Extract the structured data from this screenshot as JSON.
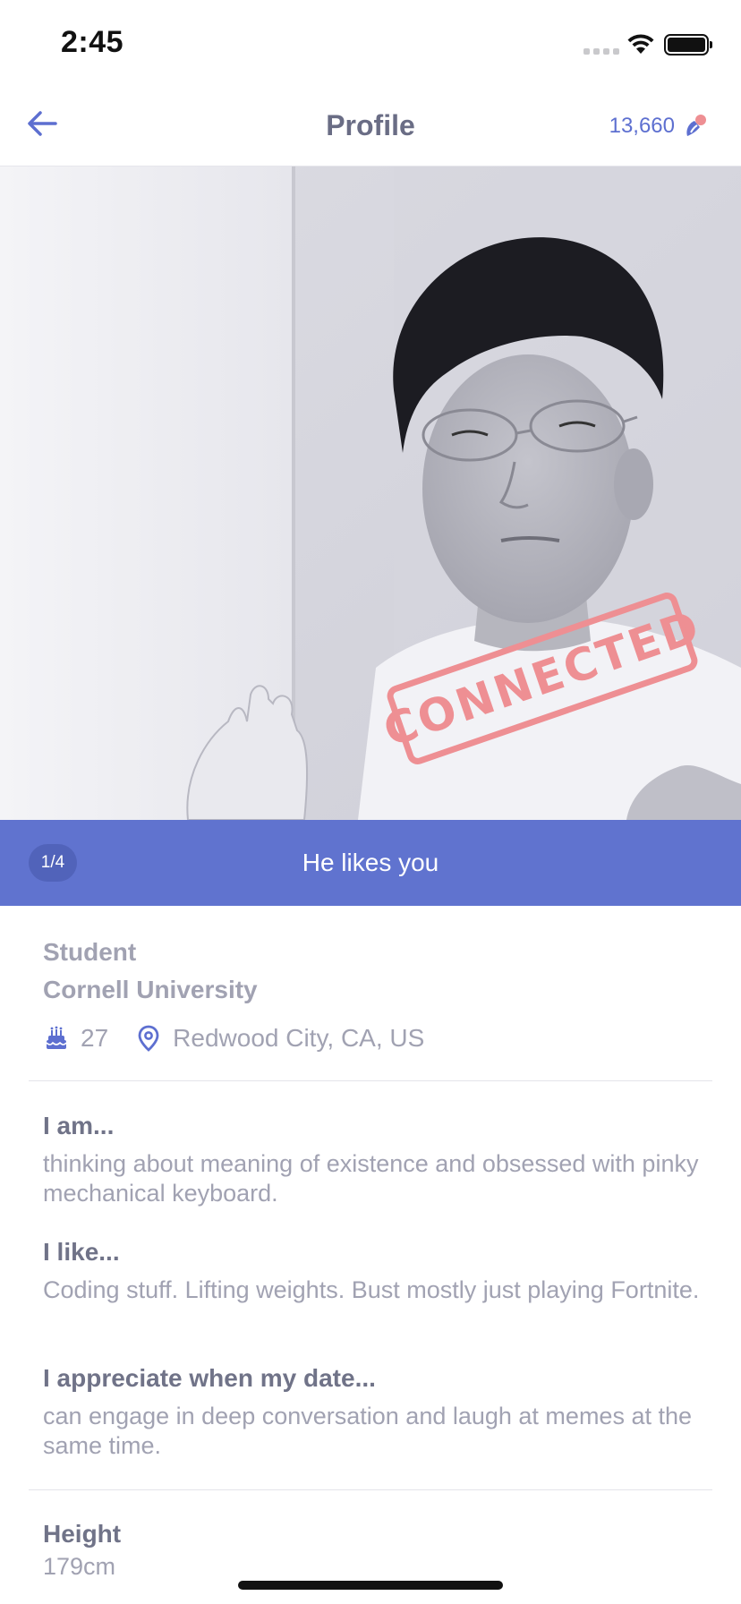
{
  "status_bar": {
    "time": "2:45"
  },
  "nav": {
    "title": "Profile",
    "credits": "13,660"
  },
  "photo": {
    "stamp": "CONNECTED"
  },
  "banner": {
    "page_indicator": "1/4",
    "text": "He likes you"
  },
  "profile": {
    "occupation": "Student",
    "school": "Cornell University",
    "age": "27",
    "location": "Redwood City, CA, US"
  },
  "prompts": [
    {
      "title": "I am...",
      "answer": "thinking about meaning of existence and obsessed with pinky mechanical keyboard."
    },
    {
      "title": "I like...",
      "answer": "Coding stuff. Lifting weights.  Bust mostly just playing Fortnite."
    },
    {
      "title": "I appreciate when my date...",
      "answer": "can engage in deep conversation and laugh at memes at the same time."
    }
  ],
  "details": {
    "height_label": "Height",
    "height_value": "179cm"
  },
  "colors": {
    "accent": "#6073cf",
    "stamp": "#ee8f93",
    "muted_text": "#a1a2b2"
  }
}
